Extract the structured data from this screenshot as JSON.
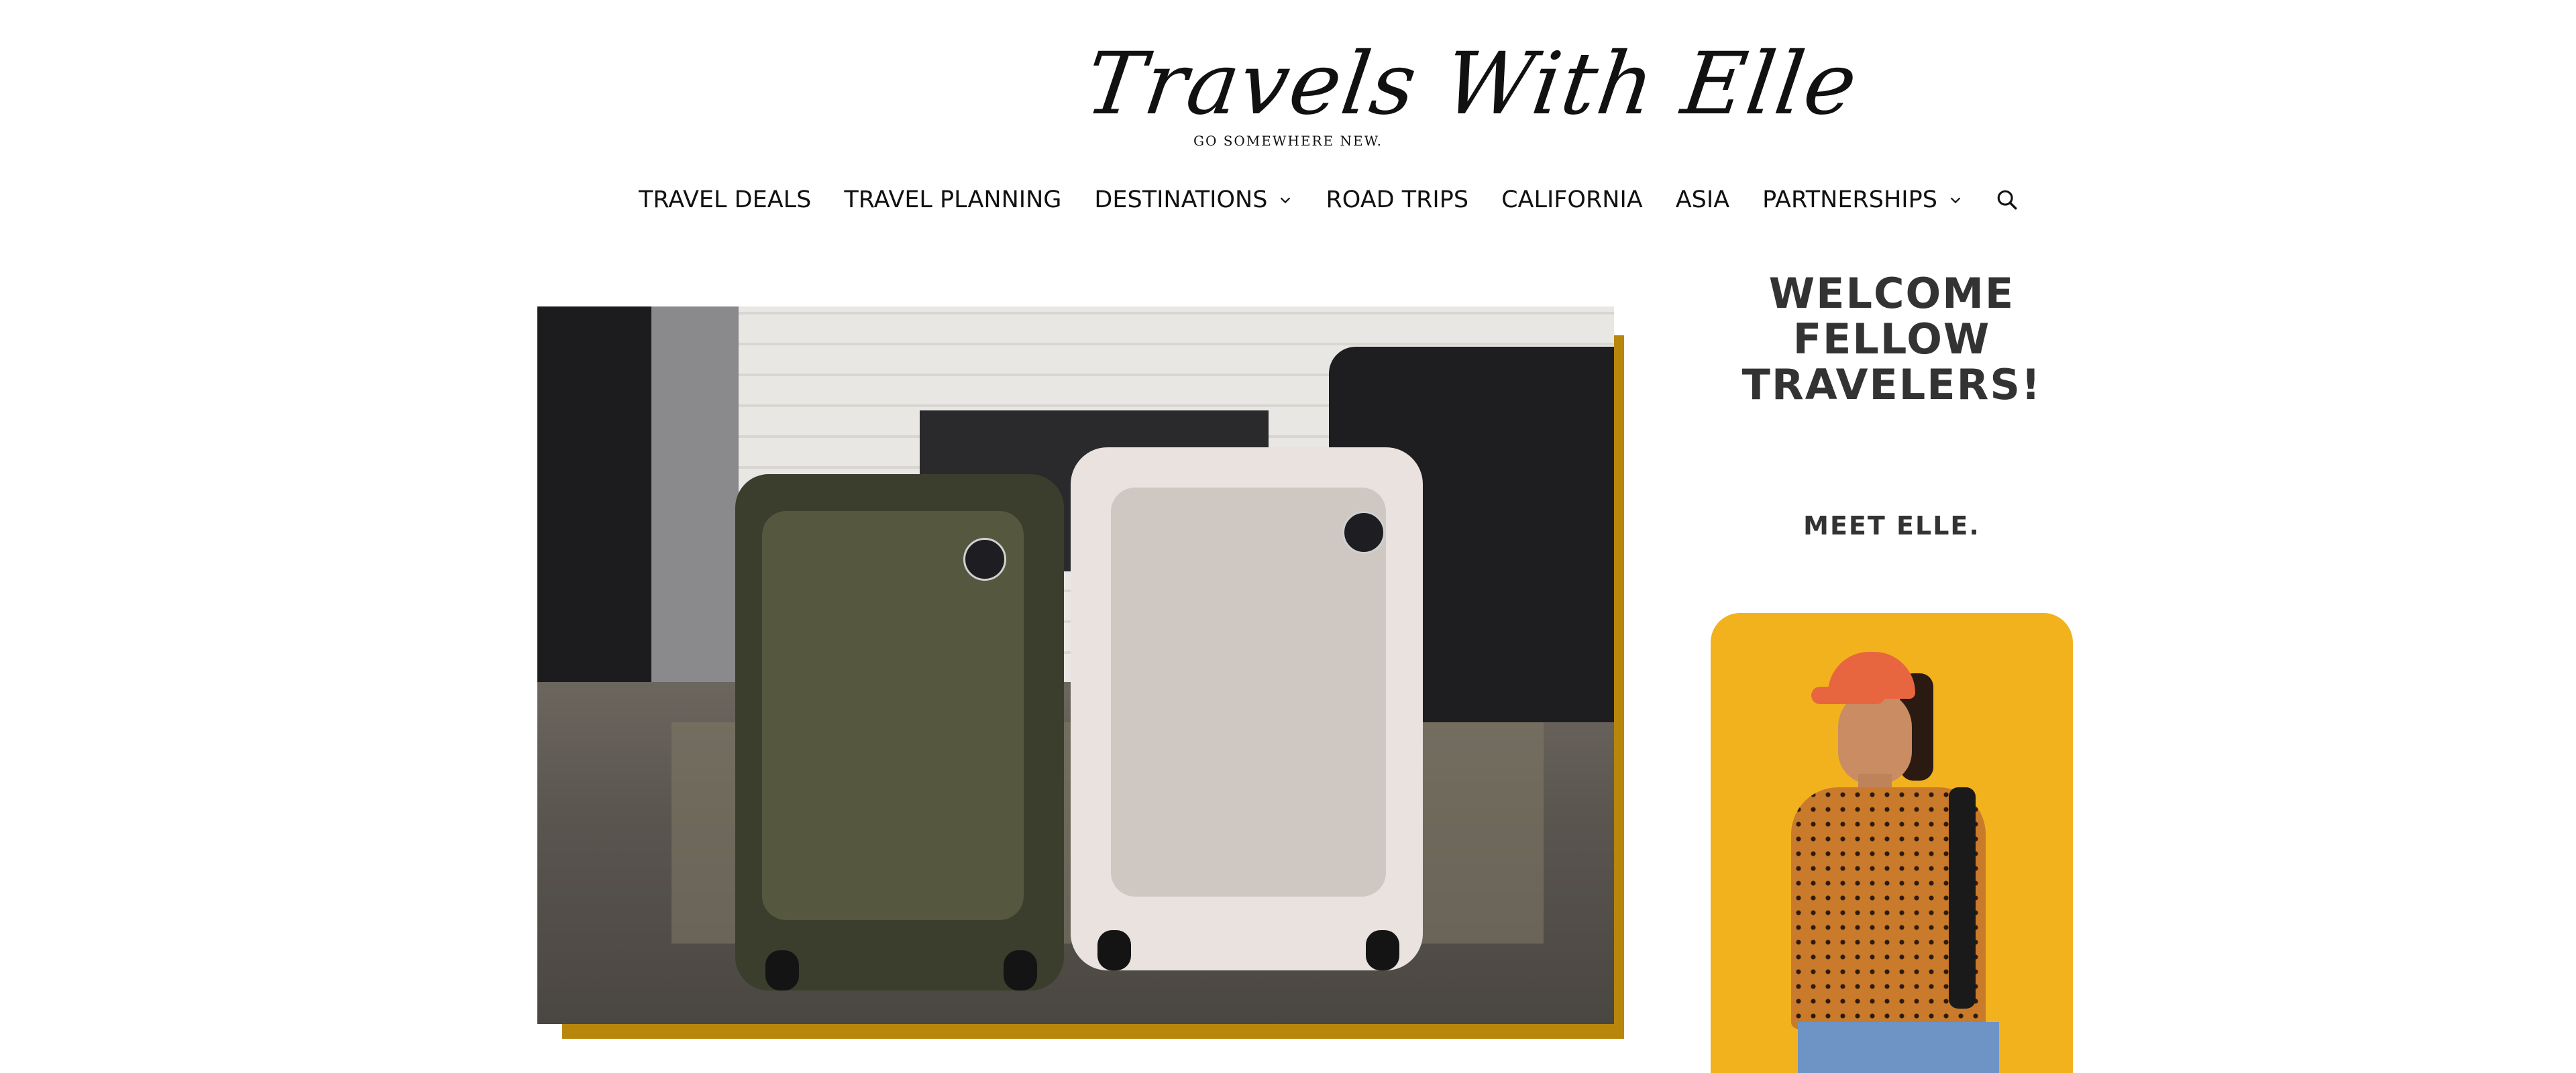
{
  "header": {
    "logo_text": "Travels With Elle",
    "tagline": "GO SOMEWHERE NEW."
  },
  "nav": {
    "items": [
      {
        "label": "TRAVEL DEALS",
        "has_dropdown": false
      },
      {
        "label": "TRAVEL PLANNING",
        "has_dropdown": false
      },
      {
        "label": "DESTINATIONS",
        "has_dropdown": true
      },
      {
        "label": "ROAD TRIPS",
        "has_dropdown": false
      },
      {
        "label": "CALIFORNIA",
        "has_dropdown": false
      },
      {
        "label": "ASIA",
        "has_dropdown": false
      },
      {
        "label": "PARTNERSHIPS",
        "has_dropdown": true
      }
    ],
    "search_icon": "search-icon",
    "dropdown_icon": "chevron-down-icon"
  },
  "sidebar": {
    "welcome_heading": "WELCOME FELLOW TRAVELERS!",
    "meet_heading": "MEET ELLE."
  },
  "colors": {
    "accent_gold": "#b8860b",
    "profile_bg": "#f2b21e",
    "heading_text": "#333333"
  }
}
